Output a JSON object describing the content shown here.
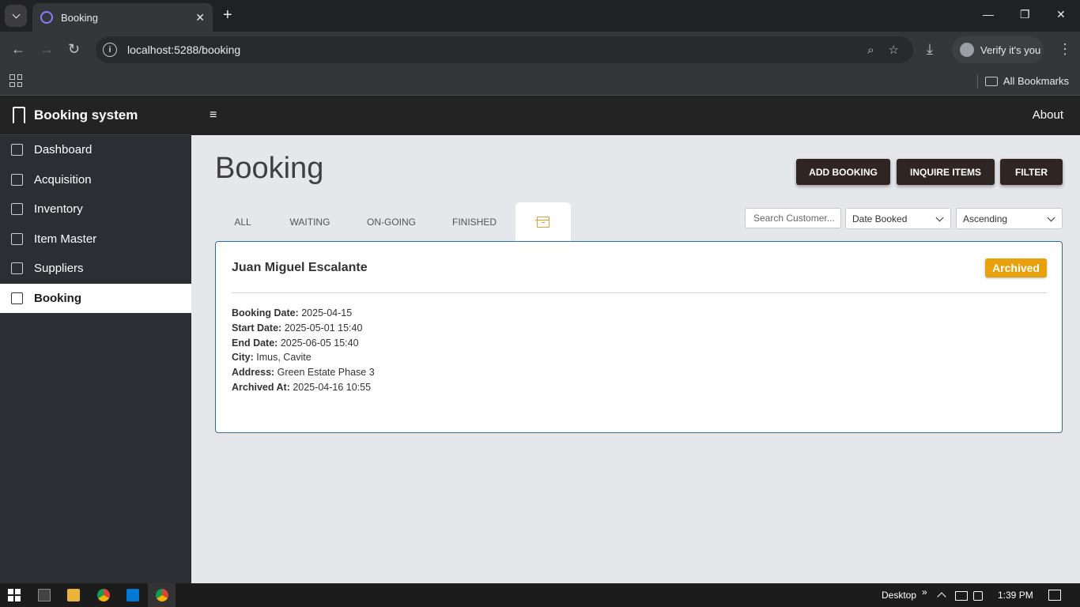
{
  "browser": {
    "tab_title": "Booking",
    "url": "localhost:5288/booking",
    "profile_label": "Verify it's you",
    "bookmarks_label": "All Bookmarks",
    "close_symbol": "✕",
    "new_tab_symbol": "+",
    "back_symbol": "←",
    "forward_symbol": "→",
    "reload_symbol": "↻",
    "minimize_symbol": "—",
    "restore_symbol": "❐",
    "close_window_symbol": "✕",
    "zoom_symbol": "⌕",
    "star_symbol": "☆",
    "download_symbol": "⤓",
    "menu_symbol": "⋮"
  },
  "sidebar": {
    "brand": "Booking system",
    "items": [
      {
        "label": "Dashboard",
        "icon": "dashboard-icon"
      },
      {
        "label": "Acquisition",
        "icon": "clipboard-check-icon"
      },
      {
        "label": "Inventory",
        "icon": "box-icon"
      },
      {
        "label": "Item Master",
        "icon": "document-icon"
      },
      {
        "label": "Suppliers",
        "icon": "truck-icon"
      },
      {
        "label": "Booking",
        "icon": "book-icon",
        "active": true
      }
    ]
  },
  "topbar": {
    "menu_symbol": "≡",
    "about_label": "About"
  },
  "main": {
    "title": "Booking",
    "buttons": {
      "add_booking": "ADD BOOKING",
      "inquire_items": "INQUIRE ITEMS",
      "filter": "FILTER"
    },
    "tabs": [
      "ALL",
      "WAITING",
      "ON-GOING",
      "FINISHED"
    ],
    "active_tab_icon": "archive-icon",
    "search_placeholder": "Search Customer...",
    "sort_field": "Date Booked",
    "sort_order": "Ascending"
  },
  "booking": {
    "customer": "Juan Miguel Escalante",
    "status": "Archived",
    "fields": [
      {
        "label": "Booking Date:",
        "value": "2025-04-15"
      },
      {
        "label": "Start Date:",
        "value": "2025-05-01 15:40"
      },
      {
        "label": "End Date:",
        "value": "2025-06-05 15:40"
      },
      {
        "label": "City:",
        "value": "Imus, Cavite"
      },
      {
        "label": "Address:",
        "value": "Green Estate Phase 3"
      },
      {
        "label": "Archived At:",
        "value": "2025-04-16 10:55"
      }
    ]
  },
  "taskbar": {
    "desktop_label": "Desktop",
    "overflow_symbol": "»",
    "time": "1:39 PM"
  },
  "colors": {
    "accent": "#e8a10c",
    "card_border": "#2f6fa8",
    "button": "#2f2624"
  }
}
